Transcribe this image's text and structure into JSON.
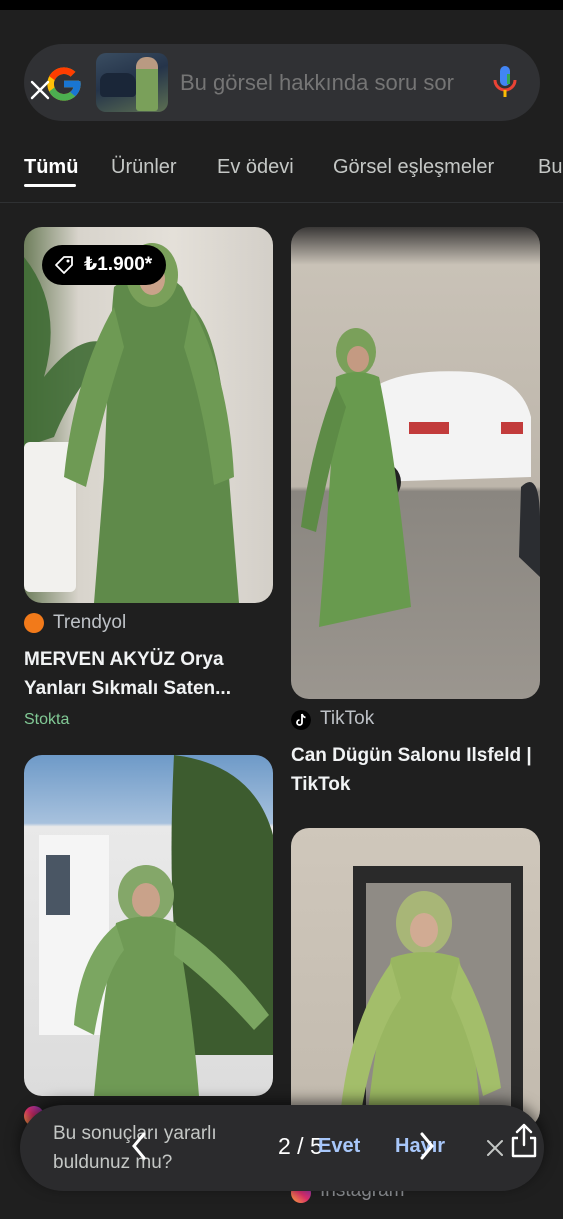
{
  "search": {
    "placeholder": "Bu görsel hakkında soru sor"
  },
  "tabs": [
    {
      "label": "Tümü",
      "active": true
    },
    {
      "label": "Ürünler",
      "active": false
    },
    {
      "label": "Ev ödevi",
      "active": false
    },
    {
      "label": "Görsel eşleşmeler",
      "active": false
    },
    {
      "label": "Bu",
      "active": false
    }
  ],
  "results": [
    {
      "source": "Trendyol",
      "title": "MERVEN AKYÜZ Orya Yanları Sıkmalı Saten...",
      "price": "₺1.900*",
      "stock": "Stokta"
    },
    {
      "source": "TikTok",
      "title": "Can Dügün Salonu Ilsfeld | TikTok"
    },
    {
      "source": "",
      "title": ""
    },
    {
      "source": "Instagram",
      "title": ""
    }
  ],
  "feedback": {
    "question": "Bu sonuçları yararlı buldunuz mu?",
    "yes_label": "Evet",
    "no_label": "Hayır",
    "pager": "2 / 5"
  },
  "colors": {
    "background": "#1f1f1f",
    "accent_link": "#a8c7fa",
    "stock_green": "#81c995"
  }
}
